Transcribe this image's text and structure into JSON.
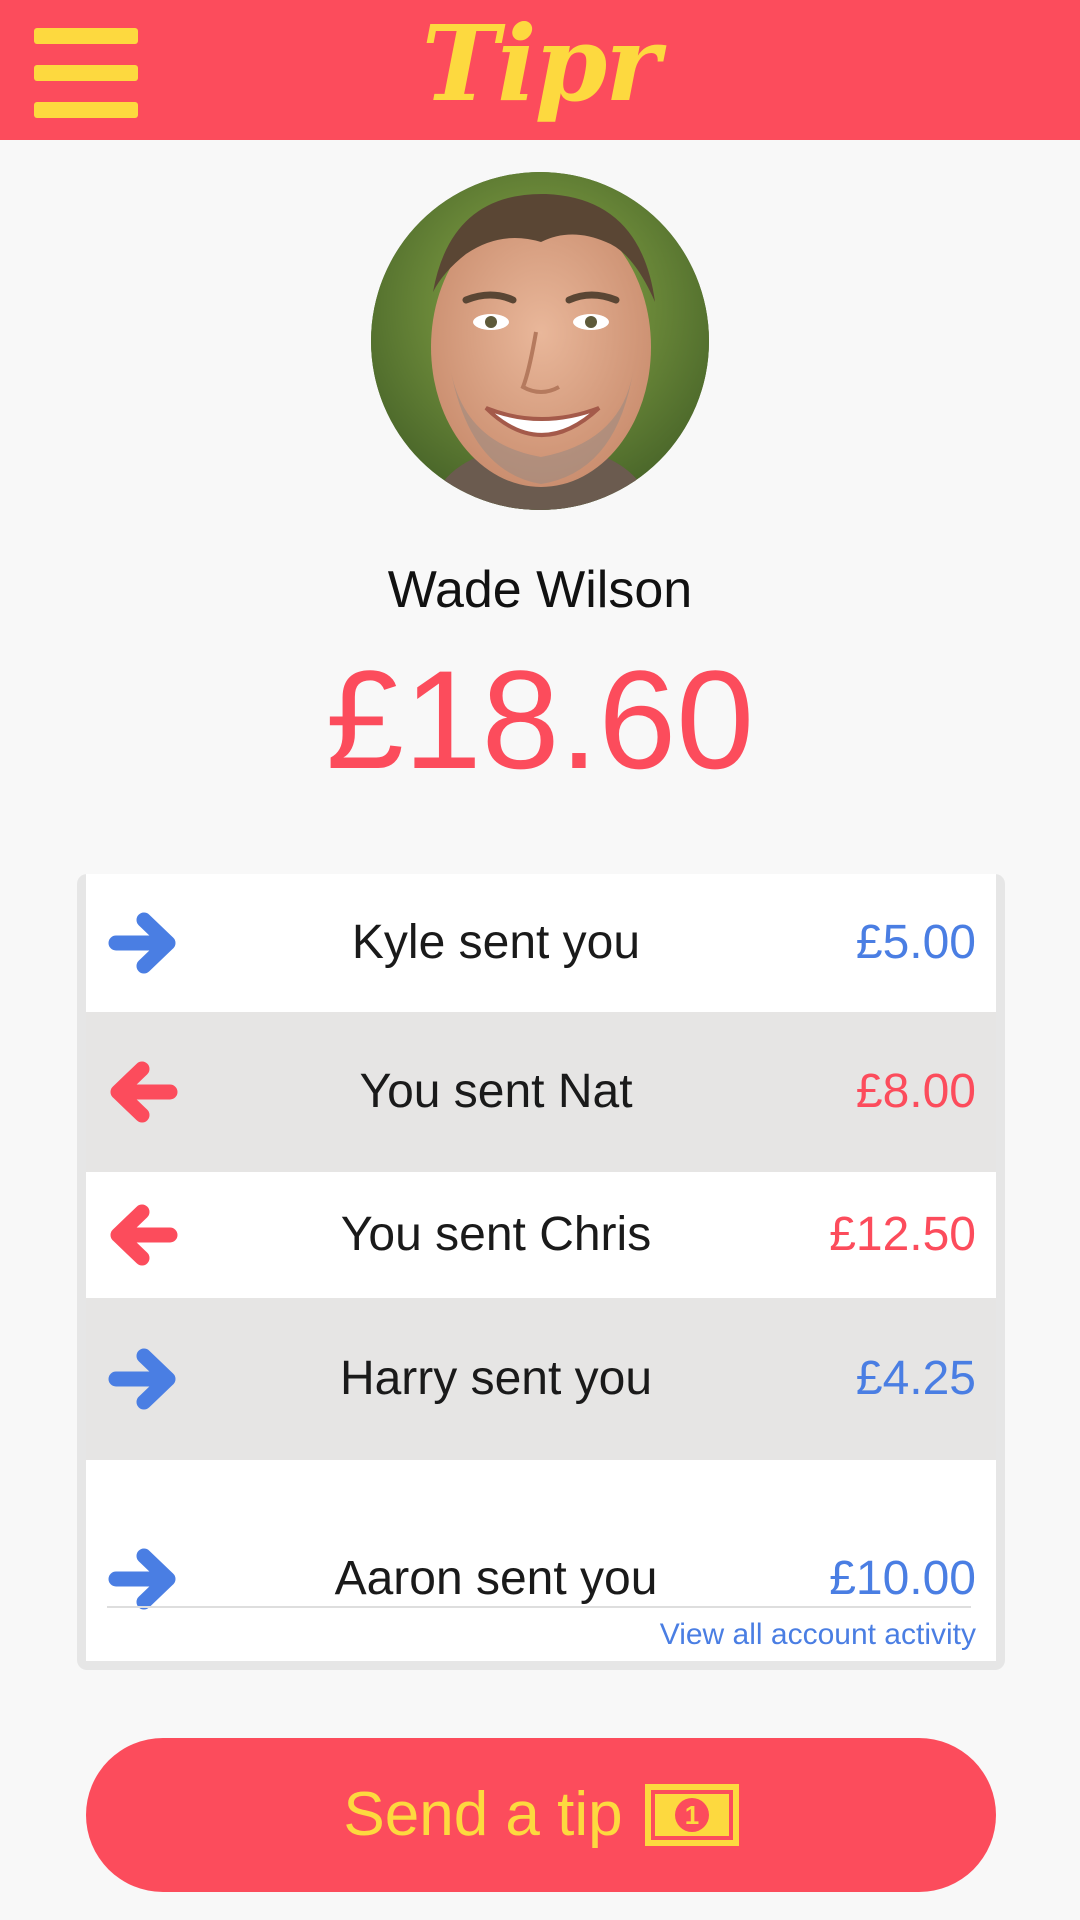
{
  "header": {
    "app_title": "Tipr",
    "menu_icon": "hamburger-menu-icon",
    "background": "#fc4c5c",
    "accent": "#fdd93f"
  },
  "profile": {
    "name": "Wade Wilson",
    "balance": "£18.60"
  },
  "activity": {
    "items": [
      {
        "direction": "incoming",
        "icon": "arrow-right-icon",
        "label": "Kyle sent you",
        "amount": "£5.00",
        "color": "#4a7ee3"
      },
      {
        "direction": "outgoing",
        "icon": "arrow-left-icon",
        "label": "You sent Nat",
        "amount": "£8.00",
        "color": "#fc4c5c"
      },
      {
        "direction": "outgoing",
        "icon": "arrow-left-icon",
        "label": "You sent Chris",
        "amount": "£12.50",
        "color": "#fc4c5c"
      },
      {
        "direction": "incoming",
        "icon": "arrow-right-icon",
        "label": "Harry sent you",
        "amount": "£4.25",
        "color": "#4a7ee3"
      },
      {
        "direction": "incoming",
        "icon": "arrow-right-icon",
        "label": "Aaron sent you",
        "amount": "£10.00",
        "color": "#4a7ee3"
      }
    ],
    "view_all_label": "View all account activity"
  },
  "send_button": {
    "label": "Send a tip",
    "icon": "banknote-icon",
    "icon_text": "1"
  }
}
